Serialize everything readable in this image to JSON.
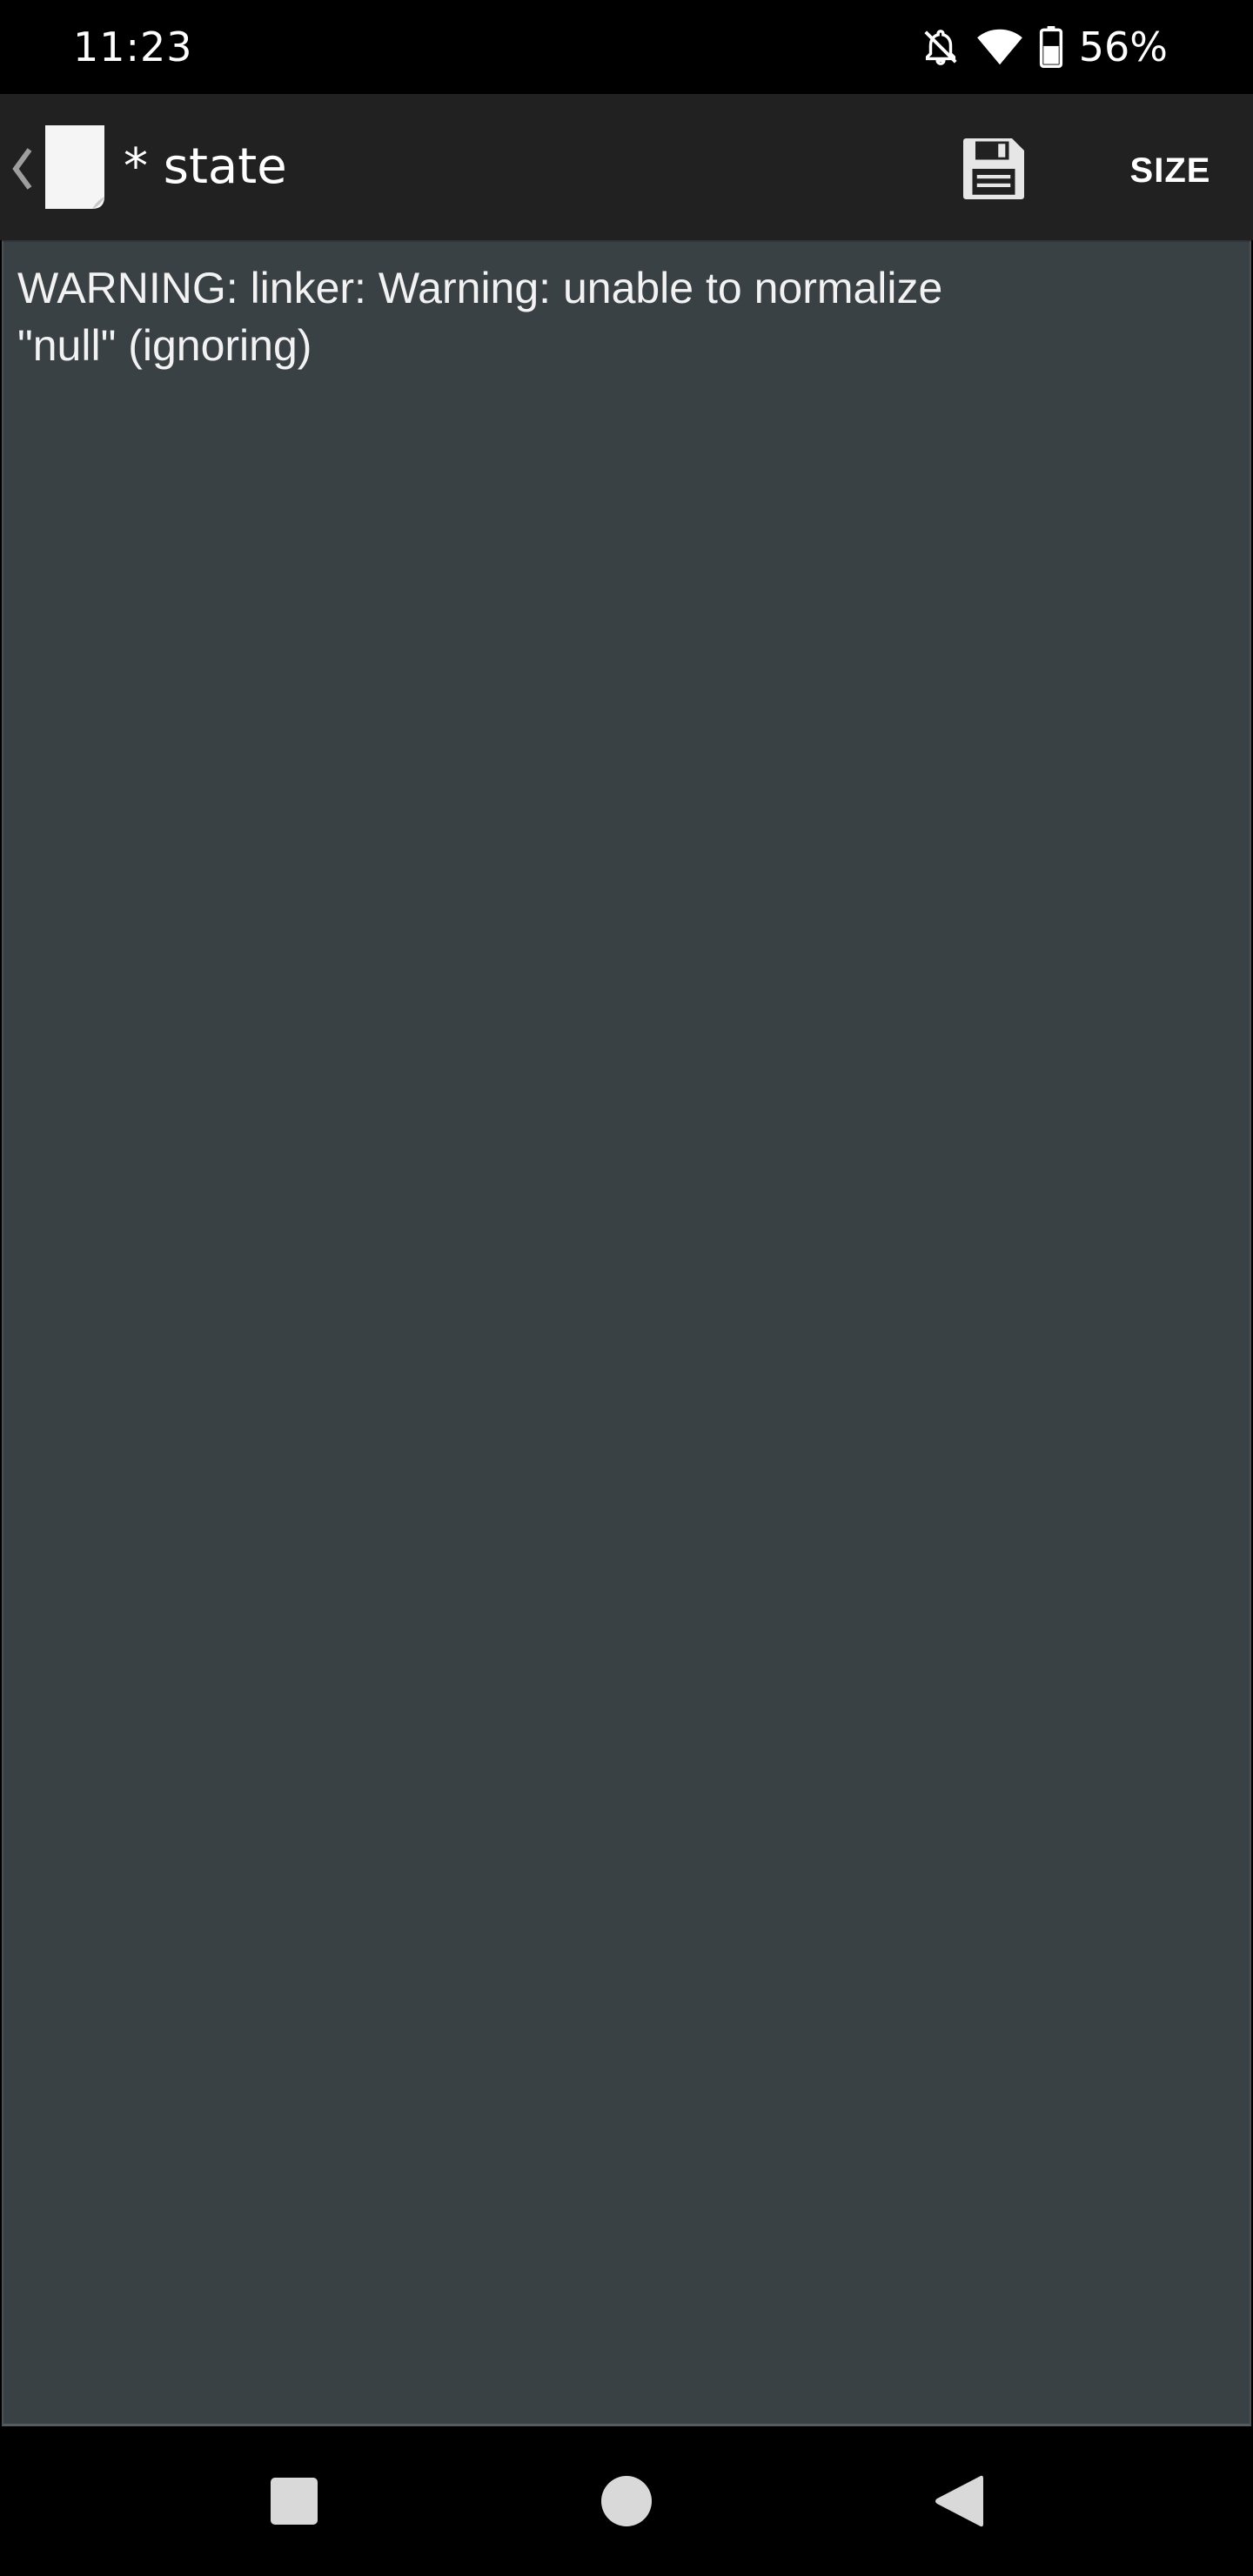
{
  "status_bar": {
    "time": "11:23",
    "battery_percent": "56%",
    "icons": [
      "notifications-off-icon",
      "wifi-icon",
      "battery-icon"
    ]
  },
  "action_bar": {
    "title": "* state",
    "size_label": "SIZE",
    "icons": [
      "back-chevron-icon",
      "document-icon",
      "save-icon"
    ]
  },
  "editor": {
    "content": "WARNING: linker: Warning: unable to normalize\n\"null\" (ignoring)"
  },
  "nav_bar": {
    "icons": [
      "recents-icon",
      "home-icon",
      "back-icon"
    ]
  },
  "colors": {
    "status_bar_bg": "#000000",
    "action_bar_bg": "#212121",
    "editor_bg": "#3a4145",
    "text": "#ffffff"
  }
}
